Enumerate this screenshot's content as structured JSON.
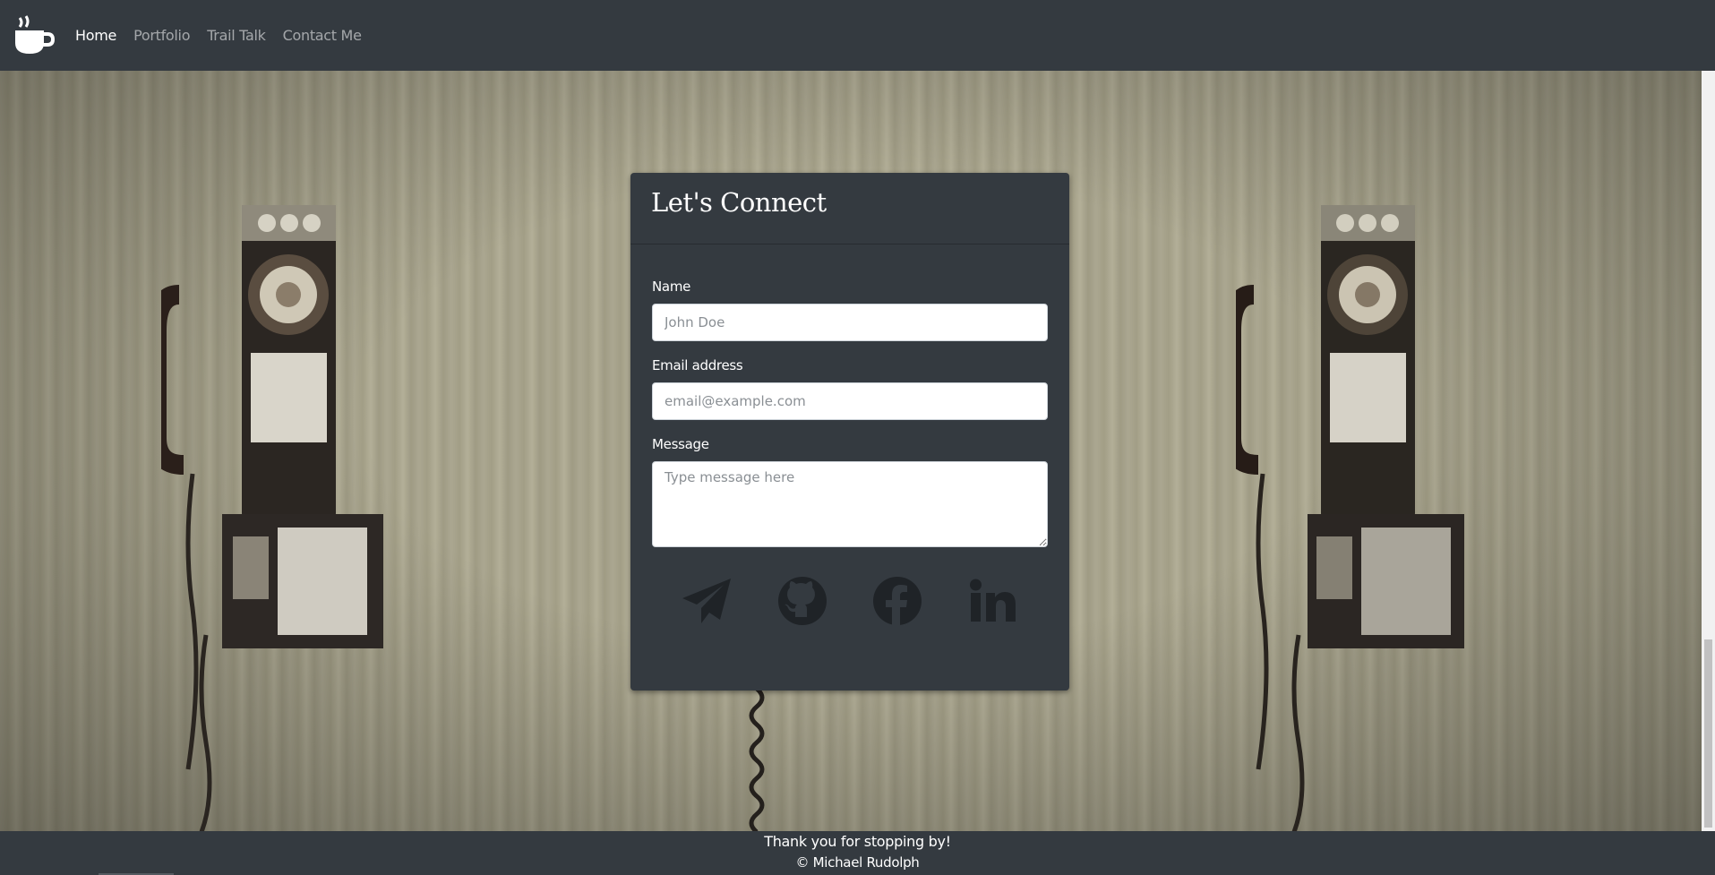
{
  "navbar": {
    "brand_icon": "coffee-cup-icon",
    "links": [
      {
        "label": "Home",
        "active": true
      },
      {
        "label": "Portfolio",
        "active": false
      },
      {
        "label": "Trail Talk",
        "active": false
      },
      {
        "label": "Contact Me",
        "active": false
      }
    ]
  },
  "contact_card": {
    "title": "Let's Connect",
    "name_label": "Name",
    "name_placeholder": "John Doe",
    "email_label": "Email address",
    "email_placeholder": "email@example.com",
    "message_label": "Message",
    "message_placeholder": "Type message here",
    "social_icons": [
      "paper-plane-icon",
      "github-icon",
      "facebook-icon",
      "linkedin-icon"
    ]
  },
  "footer": {
    "line1": "Thank you for stopping by!",
    "line2": "© Michael Rudolph"
  },
  "colors": {
    "navbar_bg": "#343a40",
    "card_bg": "#343a40",
    "icon_color": "#1f2327"
  }
}
